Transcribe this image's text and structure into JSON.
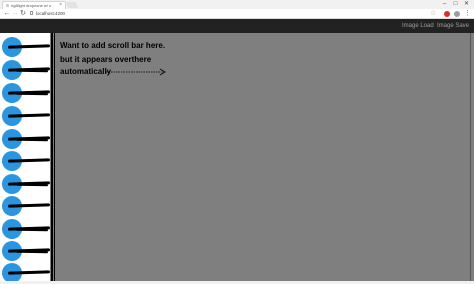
{
  "browser": {
    "tab_title": "ng8light dropzone w/ o",
    "tab_close": "×",
    "url": "localhost:4200",
    "window_controls": {
      "minimize": "–",
      "maximize": "□",
      "close": "✕"
    },
    "nav": {
      "back": "←",
      "forward": "→",
      "reload": "↻"
    },
    "star": "☆",
    "menu": "⋮"
  },
  "navbar": {
    "image_load": "Image Load",
    "image_save": "Image Save",
    "background": "#222222",
    "link_color": "#9d9d9d"
  },
  "sidebar": {
    "item_count": 11,
    "circle_color": "#2b95e0"
  },
  "main": {
    "annotation_lines": [
      "Want to add scroll bar here.",
      "but it appears overthere",
      "automatically"
    ],
    "background": "#7f7f7f"
  }
}
